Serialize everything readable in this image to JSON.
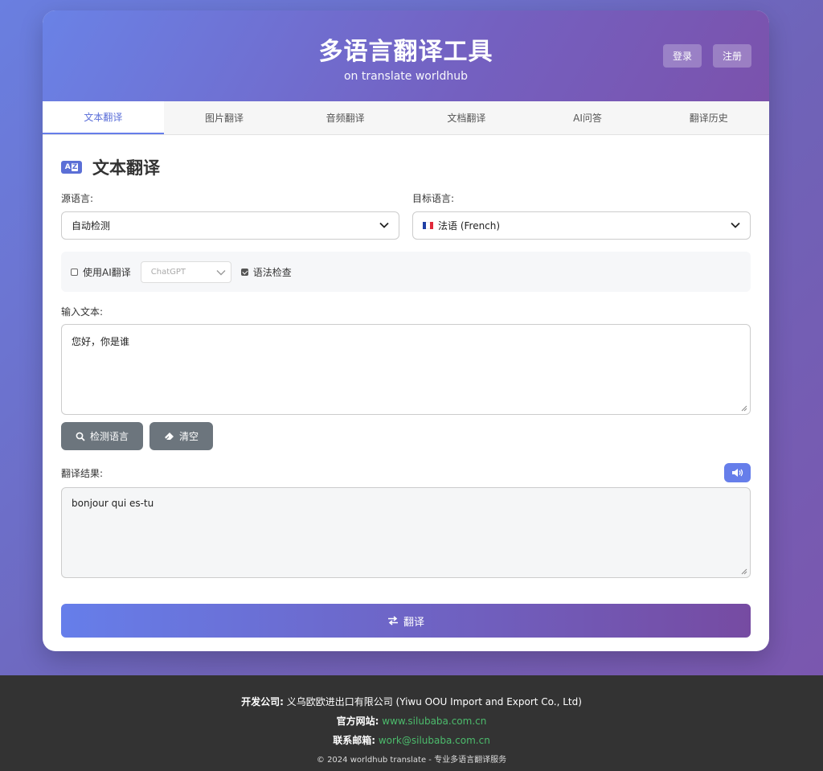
{
  "header": {
    "title": "多语言翻译工具",
    "subtitle": "on translate worldhub",
    "login_label": "登录",
    "register_label": "注册"
  },
  "tabs": [
    {
      "label": "文本翻译",
      "active": true
    },
    {
      "label": "图片翻译",
      "active": false
    },
    {
      "label": "音频翻译",
      "active": false
    },
    {
      "label": "文档翻译",
      "active": false
    },
    {
      "label": "AI问答",
      "active": false
    },
    {
      "label": "翻译历史",
      "active": false
    }
  ],
  "section": {
    "icon": "translate-az-icon",
    "title": "文本翻译"
  },
  "source_lang": {
    "label": "源语言:",
    "value": "自动检测"
  },
  "target_lang": {
    "label": "目标语言:",
    "value": "法语 (French)",
    "flag": "french-flag"
  },
  "options": {
    "use_ai_label": "使用AI翻译",
    "use_ai_checked": false,
    "ai_model": "ChatGPT",
    "grammar_check_label": "语法检查",
    "grammar_check_checked": true
  },
  "input": {
    "label": "输入文本:",
    "value": "您好，你是谁"
  },
  "actions": {
    "detect_label": "检测语言",
    "clear_label": "清空"
  },
  "result": {
    "label": "翻译结果:",
    "value": "bonjour qui es-tu"
  },
  "translate_button": "翻译",
  "footer": {
    "company_key": "开发公司:",
    "company_value": "义乌欧欧进出口有限公司 (Yiwu OOU Import and Export Co., Ltd)",
    "website_key": "官方网站:",
    "website_value": "www.silubaba.com.cn",
    "email_key": "联系邮箱:",
    "email_value": "work@silubaba.com.cn",
    "copyright": "© 2024 worldhub translate - 专业多语言翻译服务"
  },
  "colors": {
    "accent": "#667eea",
    "accent_end": "#764ba2",
    "gray_button": "#6c757d",
    "footer_bg": "#333333",
    "link": "#4cbb6c"
  }
}
